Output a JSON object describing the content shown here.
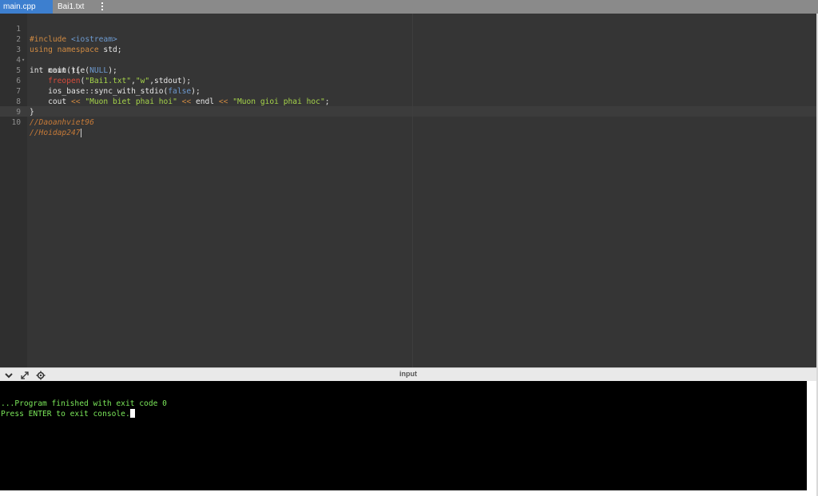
{
  "tabs": [
    {
      "label": "main.cpp",
      "active": true
    },
    {
      "label": "Bai1.txt",
      "active": false
    }
  ],
  "editor": {
    "line_numbers": [
      "1",
      "2",
      "3",
      "4",
      "5",
      "6",
      "7",
      "8",
      "9",
      "10"
    ],
    "lines": {
      "l1": {
        "pre": "#include",
        "space": " ",
        "inc": "<iostream>"
      },
      "l2": {
        "kw1": "using",
        "sp1": " ",
        "kw2": "namespace",
        "rest": " std;"
      },
      "l3": {
        "text": "int main(){"
      },
      "l4": {
        "a": "    cout.tie(",
        "const": "NULL",
        "b": ");"
      },
      "l5": {
        "indent": "    ",
        "fn": "freopen",
        "p1": "(",
        "s1": "\"Bai1.txt\"",
        "comma": ",",
        "s2": "\"w\"",
        "rest": ",stdout);"
      },
      "l6": {
        "a": "    ios_base::sync_with_stdio(",
        "const": "false",
        "b": ");"
      },
      "l7": {
        "a": "    cout ",
        "op1": "<<",
        "sp1": " ",
        "s1": "\"Muon biet phai hoi\"",
        "sp2": " ",
        "op2": "<<",
        "mid": " endl ",
        "op3": "<<",
        "sp3": " ",
        "s2": "\"Muon gioi phai hoc\"",
        "end": ";"
      },
      "l8": {
        "text": "}"
      },
      "l9": {
        "comment": "//Daoanhviet96"
      },
      "l10": {
        "comment": "//Hoidap247"
      }
    }
  },
  "console": {
    "title": "input",
    "output_line1": "...Program finished with exit code 0",
    "output_line2": "Press ENTER to exit console."
  },
  "icons": [
    "more-vertical-icon",
    "chevron-down-icon",
    "expand-icon",
    "settings-gear-icon"
  ],
  "colors": {
    "accent": "#3d7fcf",
    "editor_bg": "#353535",
    "console_text": "#7be85a"
  }
}
